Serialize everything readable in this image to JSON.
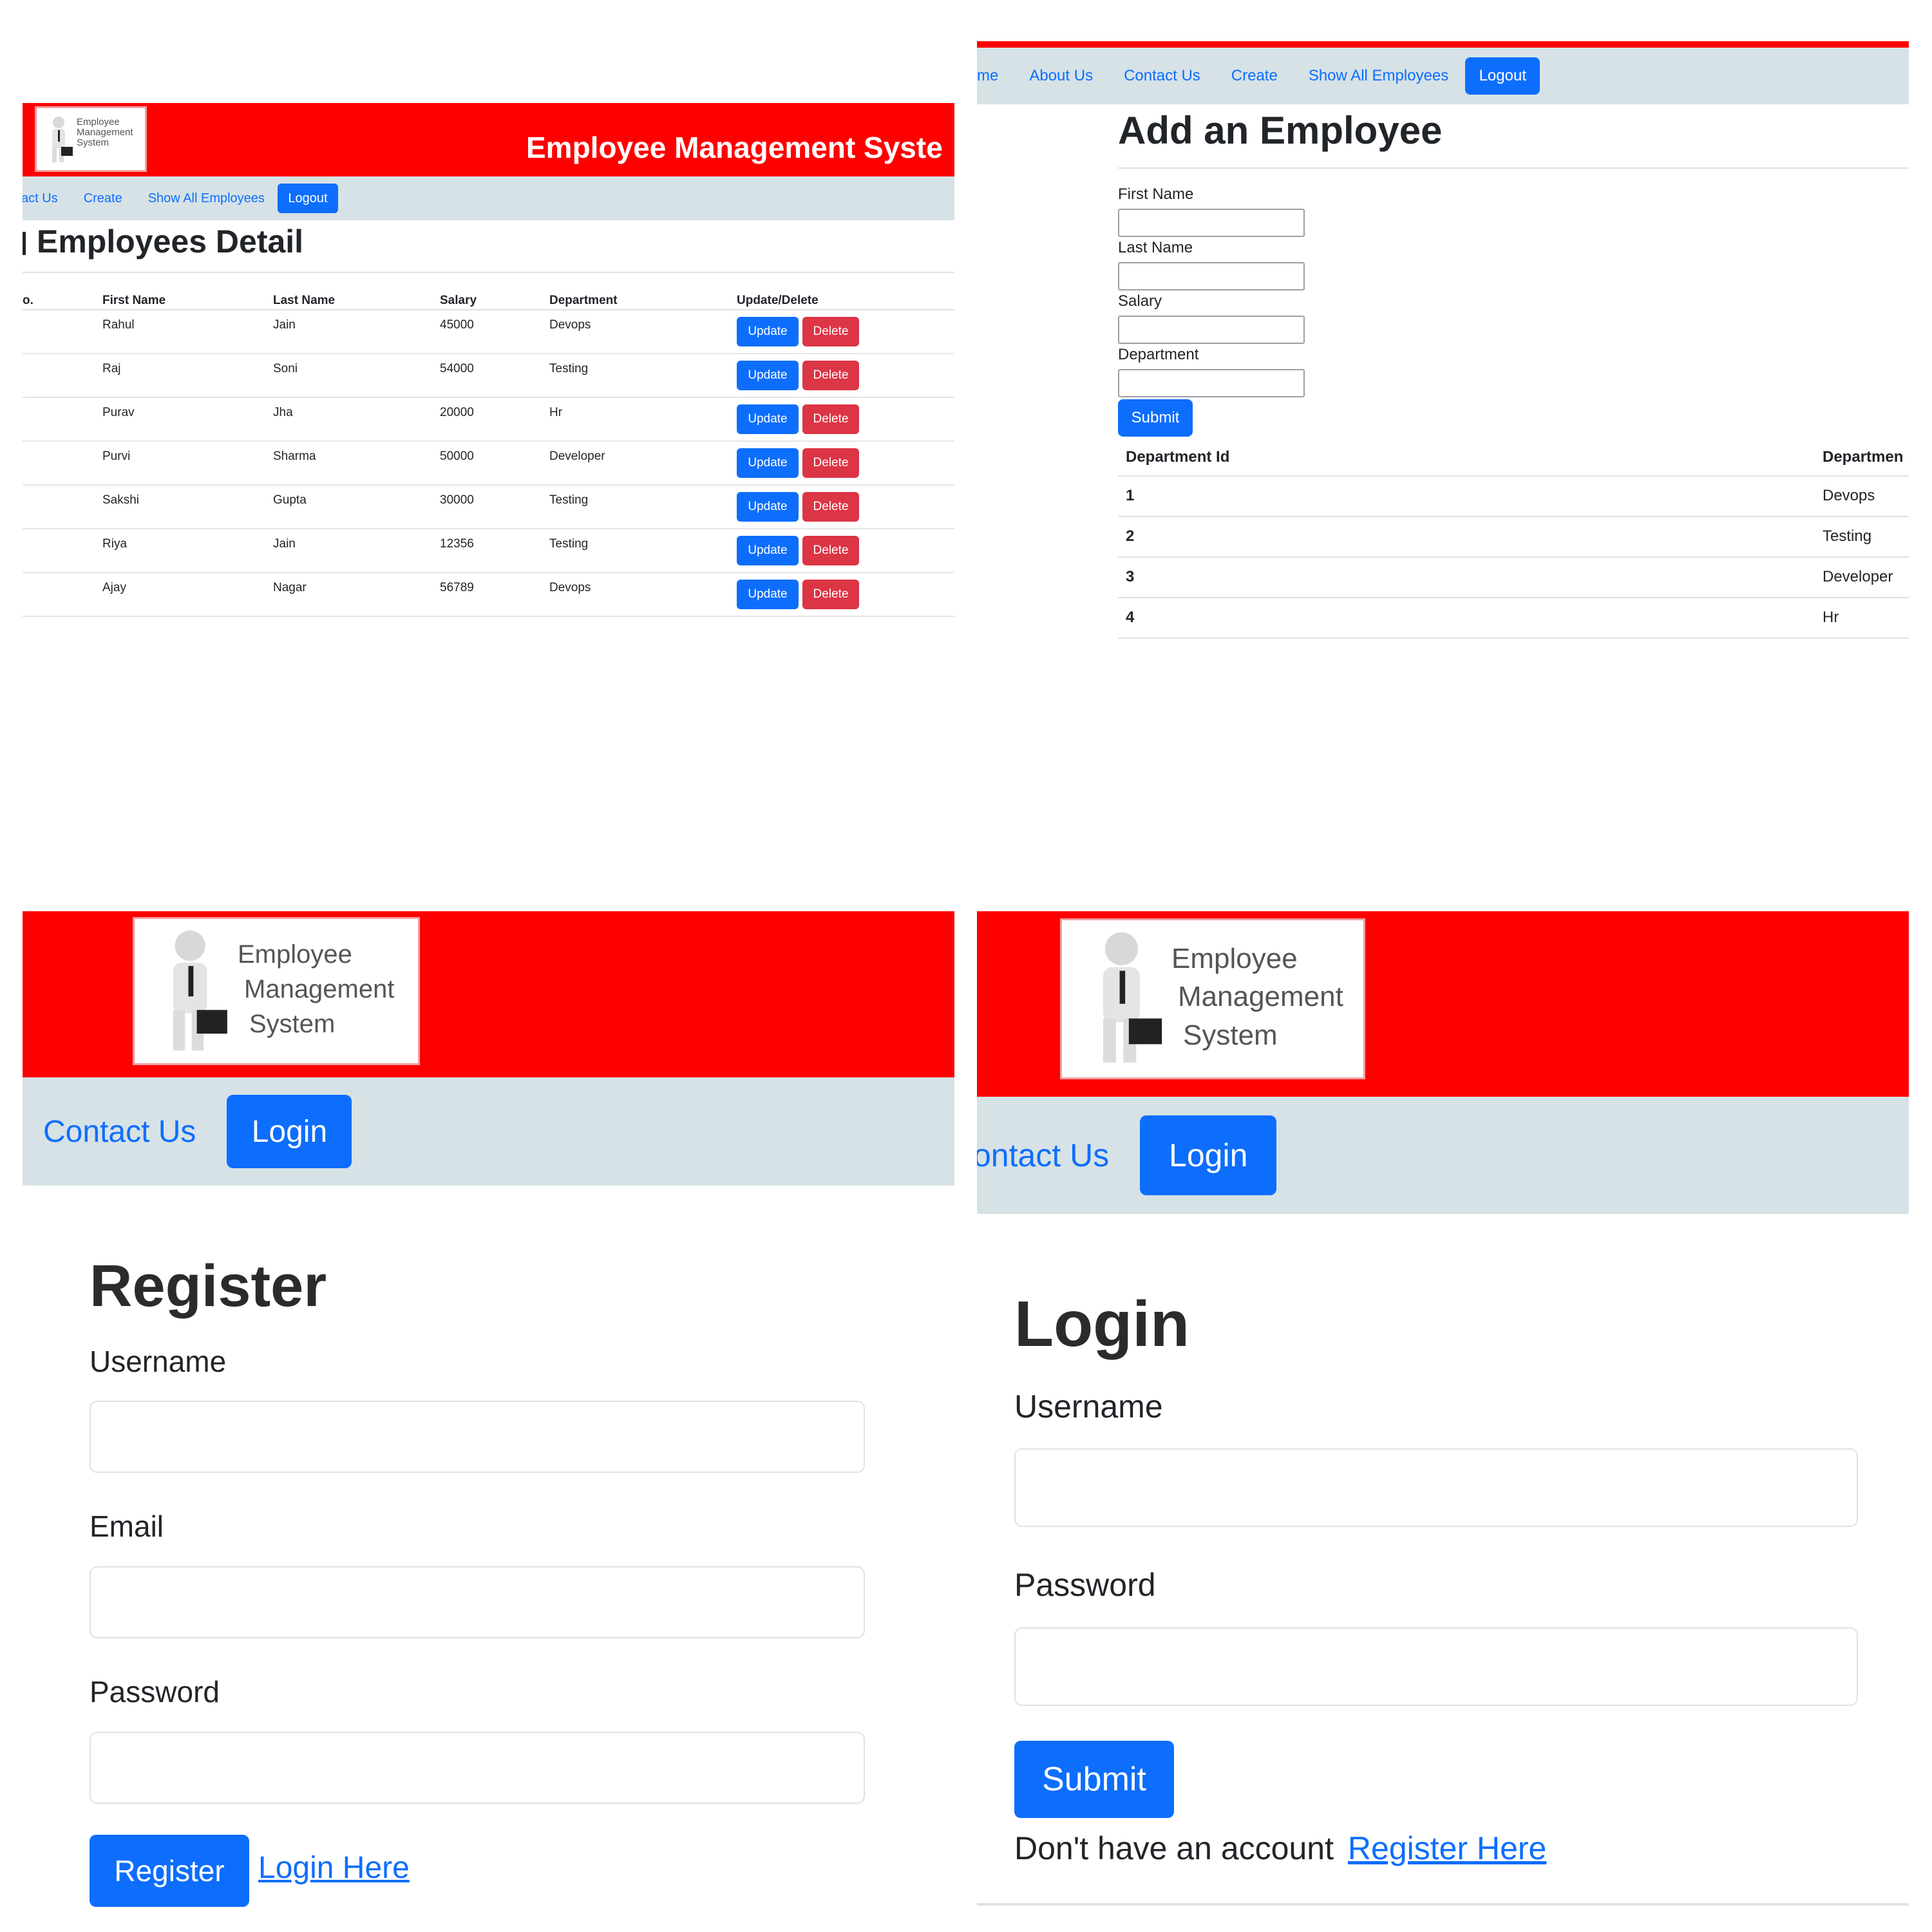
{
  "app_title": "Employee Management System",
  "logo": {
    "lines": [
      "Employee",
      "Management",
      "System"
    ],
    "icon": "businessman-with-briefcase-icon"
  },
  "colors": {
    "header": "#ff0000",
    "nav": "#d6e2e6",
    "primary": "#0d6efd",
    "danger": "#dc3545"
  },
  "employees_page": {
    "header_title": "Employee Management Syste",
    "nav": {
      "items": [
        "act Us",
        "Create",
        "Show All Employees"
      ],
      "logout": "Logout"
    },
    "heading": "Employees Detail",
    "columns": [
      "o.",
      "First Name",
      "Last Name",
      "Salary",
      "Department",
      "Update/Delete"
    ],
    "rows": [
      {
        "first": "Rahul",
        "last": "Jain",
        "salary": "45000",
        "dept": "Devops"
      },
      {
        "first": "Raj",
        "last": "Soni",
        "salary": "54000",
        "dept": "Testing"
      },
      {
        "first": "Purav",
        "last": "Jha",
        "salary": "20000",
        "dept": "Hr"
      },
      {
        "first": "Purvi",
        "last": "Sharma",
        "salary": "50000",
        "dept": "Developer"
      },
      {
        "first": "Sakshi",
        "last": "Gupta",
        "salary": "30000",
        "dept": "Testing"
      },
      {
        "first": "Riya",
        "last": "Jain",
        "salary": "12356",
        "dept": "Testing"
      },
      {
        "first": "Ajay",
        "last": "Nagar",
        "salary": "56789",
        "dept": "Devops"
      }
    ],
    "update_label": "Update",
    "delete_label": "Delete"
  },
  "add_page": {
    "nav": {
      "items": [
        "me",
        "About Us",
        "Contact Us",
        "Create",
        "Show All Employees"
      ],
      "logout": "Logout"
    },
    "heading": "Add an Employee",
    "fields": [
      "First Name",
      "Last Name",
      "Salary",
      "Department"
    ],
    "submit": "Submit",
    "dept_columns": [
      "Department Id",
      "Departmen"
    ],
    "departments": [
      {
        "id": "1",
        "name": "Devops"
      },
      {
        "id": "2",
        "name": "Testing"
      },
      {
        "id": "3",
        "name": "Developer"
      },
      {
        "id": "4",
        "name": "Hr"
      }
    ]
  },
  "register_page": {
    "nav": {
      "contact": "Contact Us",
      "login": "Login"
    },
    "heading": "Register",
    "fields": [
      "Username",
      "Email",
      "Password"
    ],
    "submit": "Register",
    "login_link": "Login Here"
  },
  "login_page": {
    "nav": {
      "contact": "ontact Us",
      "login": "Login"
    },
    "heading": "Login",
    "fields": [
      "Username",
      "Password"
    ],
    "submit": "Submit",
    "register_prompt": "Don't have an account",
    "register_link": "Register Here"
  }
}
